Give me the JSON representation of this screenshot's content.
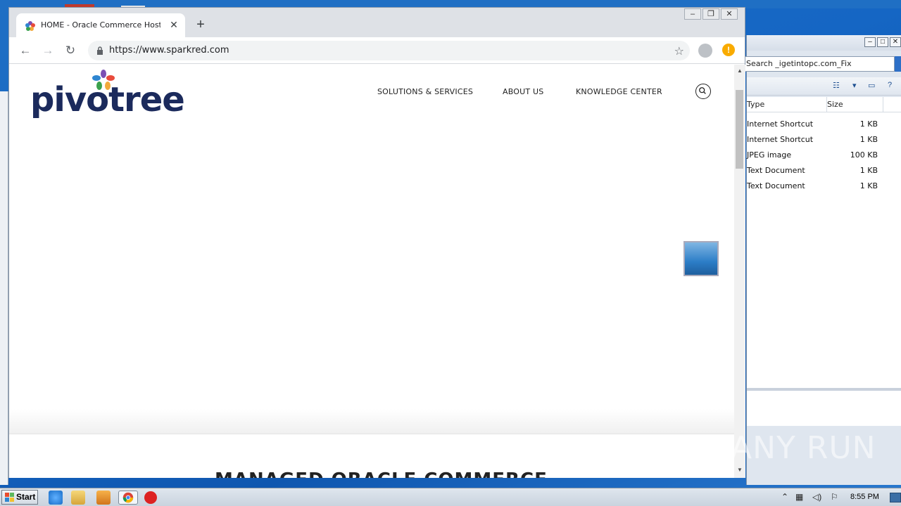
{
  "browser": {
    "tab_title": "HOME - Oracle Commerce Hosting | S",
    "url": "https://www.sparkred.com",
    "new_tab_glyph": "+",
    "tab_close_glyph": "✕"
  },
  "site": {
    "logo_text": "pivotree",
    "nav": [
      "SOLUTIONS & SERVICES",
      "ABOUT US",
      "KNOWLEDGE CENTER"
    ],
    "heading_partial": "MANAGED ORACLE COMMERCE"
  },
  "explorer": {
    "search_text": "Search _igetintopc.com_Fix",
    "columns": [
      "Type",
      "Size"
    ],
    "rows": [
      {
        "type": "Internet Shortcut",
        "size": "1 KB"
      },
      {
        "type": "Internet Shortcut",
        "size": "1 KB"
      },
      {
        "type": "JPEG image",
        "size": "100 KB"
      },
      {
        "type": "Text Document",
        "size": "1 KB"
      },
      {
        "type": "Text Document",
        "size": "1 KB"
      }
    ]
  },
  "taskbar": {
    "start_label": "Start",
    "clock": "8:55 PM"
  },
  "watermark": "ANY RUN",
  "colors": {
    "logo_navy": "#1b2a5c",
    "chrome_tabstrip": "#dee1e6",
    "alert": "#f9ab00",
    "desktop_blue": "#1566c4"
  }
}
